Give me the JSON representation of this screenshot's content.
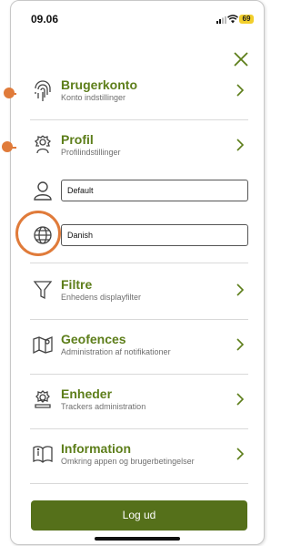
{
  "status": {
    "time": "09.06",
    "battery": "69"
  },
  "menu": {
    "account": {
      "title": "Brugerkonto",
      "subtitle": "Konto indstillinger"
    },
    "profile": {
      "title": "Profil",
      "subtitle": "Profilindstillinger"
    },
    "user_field": {
      "value": "Default"
    },
    "language_field": {
      "value": "Danish"
    },
    "filters": {
      "title": "Filtre",
      "subtitle": "Enhedens displayfilter"
    },
    "geofences": {
      "title": "Geofences",
      "subtitle": "Administration af notifikationer"
    },
    "devices": {
      "title": "Enheder",
      "subtitle": "Trackers administration"
    },
    "information": {
      "title": "Information",
      "subtitle": "Omkring appen og brugerbetingelser"
    }
  },
  "logout_label": "Log ud",
  "colors": {
    "accent": "#5d7e1a",
    "button": "#55701a",
    "annotation": "#e07b3a"
  }
}
